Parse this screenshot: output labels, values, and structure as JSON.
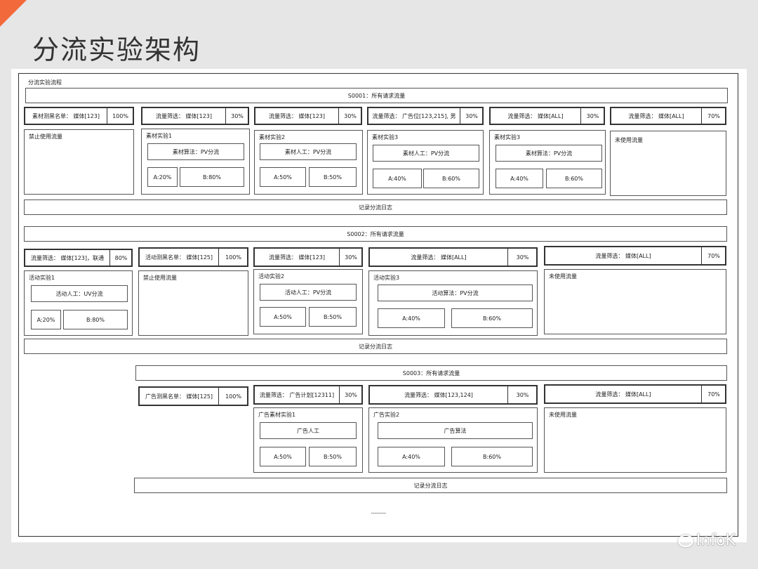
{
  "slide": {
    "title": "分流实验架构"
  },
  "diagram_label": "分流实验流程",
  "s1": {
    "header": "S0001：所有请求流量",
    "filters": [
      {
        "label": "素材测黑名单：   媒体[123]",
        "pct": "100%"
      },
      {
        "label": "流量筛选：   媒体[123]",
        "pct": "30%"
      },
      {
        "label": "流量筛选：   媒体[123]",
        "pct": "30%"
      },
      {
        "label": "流量筛选：  广告位[123,215], 男",
        "pct": "30%"
      },
      {
        "label": "流量筛选：   媒体[ALL]",
        "pct": "30%"
      },
      {
        "label": "流量筛选：   媒体[ALL]",
        "pct": "70%"
      }
    ],
    "unused1": "禁止使用流量",
    "exp1": {
      "name": "素材实验1",
      "method": "素材算法：PV分流",
      "a": "A:20%",
      "b": "B:80%"
    },
    "exp2": {
      "name": "素材实验2",
      "method": "素材人工：PV分流",
      "a": "A:50%",
      "b": "B:50%"
    },
    "exp3": {
      "name": "素材实验3",
      "method": "素材人工：PV分流",
      "a": "A:40%",
      "b": "B:60%"
    },
    "exp4": {
      "name": "素材实验3",
      "method": "素材算法：PV分流",
      "a": "A:40%",
      "b": "B:60%"
    },
    "unused2": "未使用流量",
    "log": "记录分流日志"
  },
  "s2": {
    "header": "S0002：所有请求流量",
    "filters": [
      {
        "label": "流量筛选：   媒体[123]，联通",
        "pct": "80%"
      },
      {
        "label": "活动测黑名单：   媒体[125]",
        "pct": "100%"
      },
      {
        "label": "流量筛选：   媒体[123]",
        "pct": "30%"
      },
      {
        "label": "流量筛选：   媒体[ALL]",
        "pct": "30%"
      },
      {
        "label": "流量筛选：   媒体[ALL]",
        "pct": "70%"
      }
    ],
    "exp1": {
      "name": "活动实验1",
      "method": "活动人工：UV分流",
      "a": "A:20%",
      "b": "B:80%"
    },
    "unused1": "禁止使用流量",
    "exp2": {
      "name": "活动实验2",
      "method": "活动人工：PV分流",
      "a": "A:50%",
      "b": "B:50%"
    },
    "exp3": {
      "name": "活动实验3",
      "method": "活动算法：PV分流",
      "a": "A:40%",
      "b": "B:60%"
    },
    "unused2": "未使用流量",
    "log": "记录分流日志"
  },
  "s3": {
    "header": "S0003：所有请求流量",
    "filters": [
      {
        "label": "广告测黑名单：   媒体[125]",
        "pct": "100%"
      },
      {
        "label": "流量筛选：  广告计划[12311]",
        "pct": "30%"
      },
      {
        "label": "流量筛选：   媒体[123,124]",
        "pct": "30%"
      },
      {
        "label": "流量筛选：   媒体[ALL]",
        "pct": "70%"
      }
    ],
    "exp1": {
      "name": "广告素材实验1",
      "method": "广告人工",
      "a": "A:50%",
      "b": "B:50%"
    },
    "exp2": {
      "name": "广告实验2",
      "method": "广告算法",
      "a": "A:40%",
      "b": "B:60%"
    },
    "unused": "未使用流量",
    "log": "记录分流日志"
  },
  "ellipsis": "..............",
  "watermark": "InfoK"
}
